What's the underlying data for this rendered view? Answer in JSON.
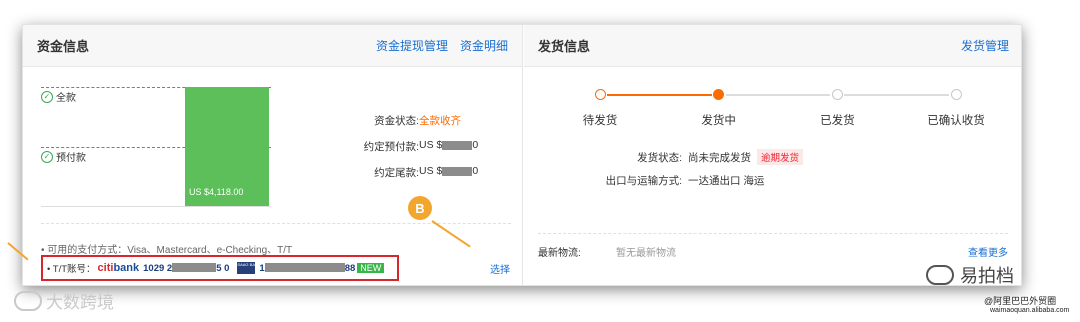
{
  "funds": {
    "title": "资金信息",
    "links": [
      "资金提现管理",
      "资金明细"
    ],
    "chart_data": {
      "type": "bar",
      "categories": [
        "全款",
        "预付款"
      ],
      "bar_label": "US $4,118.00",
      "values": [
        4118.0
      ]
    },
    "status_label": "资金状态:",
    "status_value": "全款收齐",
    "prepay_label": "约定预付款:",
    "prepay_prefix": "US $",
    "prepay_suffix": "0",
    "balance_label": "约定尾款:",
    "balance_prefix": "US $",
    "balance_suffix": "0",
    "pay_methods": "• 可用的支付方式：Visa、Mastercard、e-Checking、T/T",
    "tt_label": "• T/T账号：",
    "bank1_name_a": "citi",
    "bank1_name_b": "bank",
    "bank1_acct_a": "1029 2",
    "bank1_acct_b": "5 0",
    "bank2_logo_text": "SAAG BANK",
    "bank2_acct_a": "1",
    "bank2_acct_b": "88",
    "new_badge": "NEW",
    "select_link": "选择",
    "badge_b": "B"
  },
  "shipping": {
    "title": "发货信息",
    "manage_link": "发货管理",
    "steps": [
      {
        "label": "待发货",
        "state": "done"
      },
      {
        "label": "发货中",
        "state": "current"
      },
      {
        "label": "已发货",
        "state": "todo"
      },
      {
        "label": "已确认收货",
        "state": "todo"
      }
    ],
    "status_label": "发货状态:",
    "status_value": "尚未完成发货",
    "overdue_tag": "逾期发货",
    "method_label": "出口与运输方式:",
    "method_value": "一达通出口 海运",
    "logistics_label": "最新物流:",
    "logistics_value": "暂无最新物流",
    "more_link": "查看更多"
  },
  "watermark": {
    "left": "大数跨境",
    "right_brand": "易拍档",
    "right_sub1": "@阿里巴巴外贸圈",
    "right_sub2": "waimaoquan.alibaba.com"
  },
  "colors": {
    "accent_orange": "#ff6a00",
    "bar_green": "#5cbf59",
    "link_blue": "#1a6fd1",
    "highlight_red": "#d9262c"
  }
}
